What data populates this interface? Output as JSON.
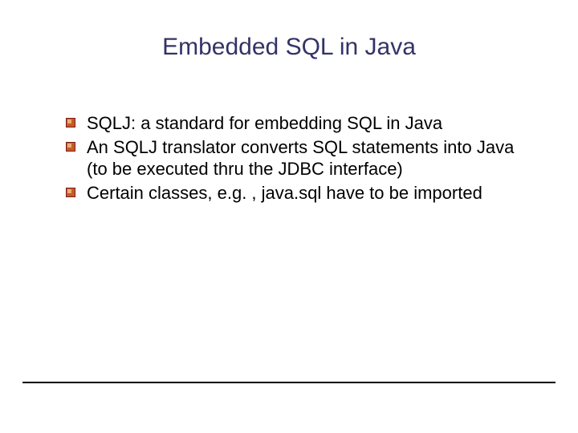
{
  "title": "Embedded SQL in Java",
  "bullets": [
    {
      "text": "SQLJ: a standard for embedding SQL in Java"
    },
    {
      "text": "An SQLJ translator converts SQL statements into Java (to be executed thru the JDBC interface)"
    },
    {
      "text": "Certain classes, e.g. , java.sql have to be imported"
    }
  ]
}
